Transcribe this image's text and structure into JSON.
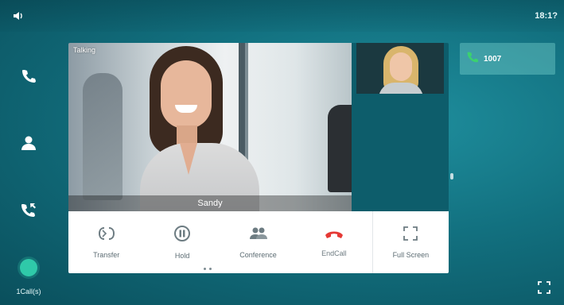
{
  "statusbar": {
    "time": "18:1?"
  },
  "icons": {
    "volume": "speaker-icon",
    "phone": "phone-icon",
    "contacts": "contact-icon",
    "history": "call-history-icon",
    "transfer": "transfer-icon",
    "hold": "pause-icon",
    "conference": "conference-icon",
    "endcall": "end-call-icon",
    "fullscreen": "fullscreen-icon",
    "expand": "expand-icon"
  },
  "video": {
    "talking_label": "Talking",
    "remote_name": "Sandy"
  },
  "callstatus": {
    "label": "1Call(s)"
  },
  "controls": [
    {
      "label": "Transfer"
    },
    {
      "label": "Hold"
    },
    {
      "label": "Conference"
    },
    {
      "label": "EndCall"
    },
    {
      "label": "Full Screen"
    }
  ],
  "line": {
    "number": "1007"
  },
  "colors": {
    "background": "#12707f",
    "accent_green": "#2fc9a9",
    "end_call_red": "#e53935",
    "line_icon_green": "#3bd16f"
  }
}
